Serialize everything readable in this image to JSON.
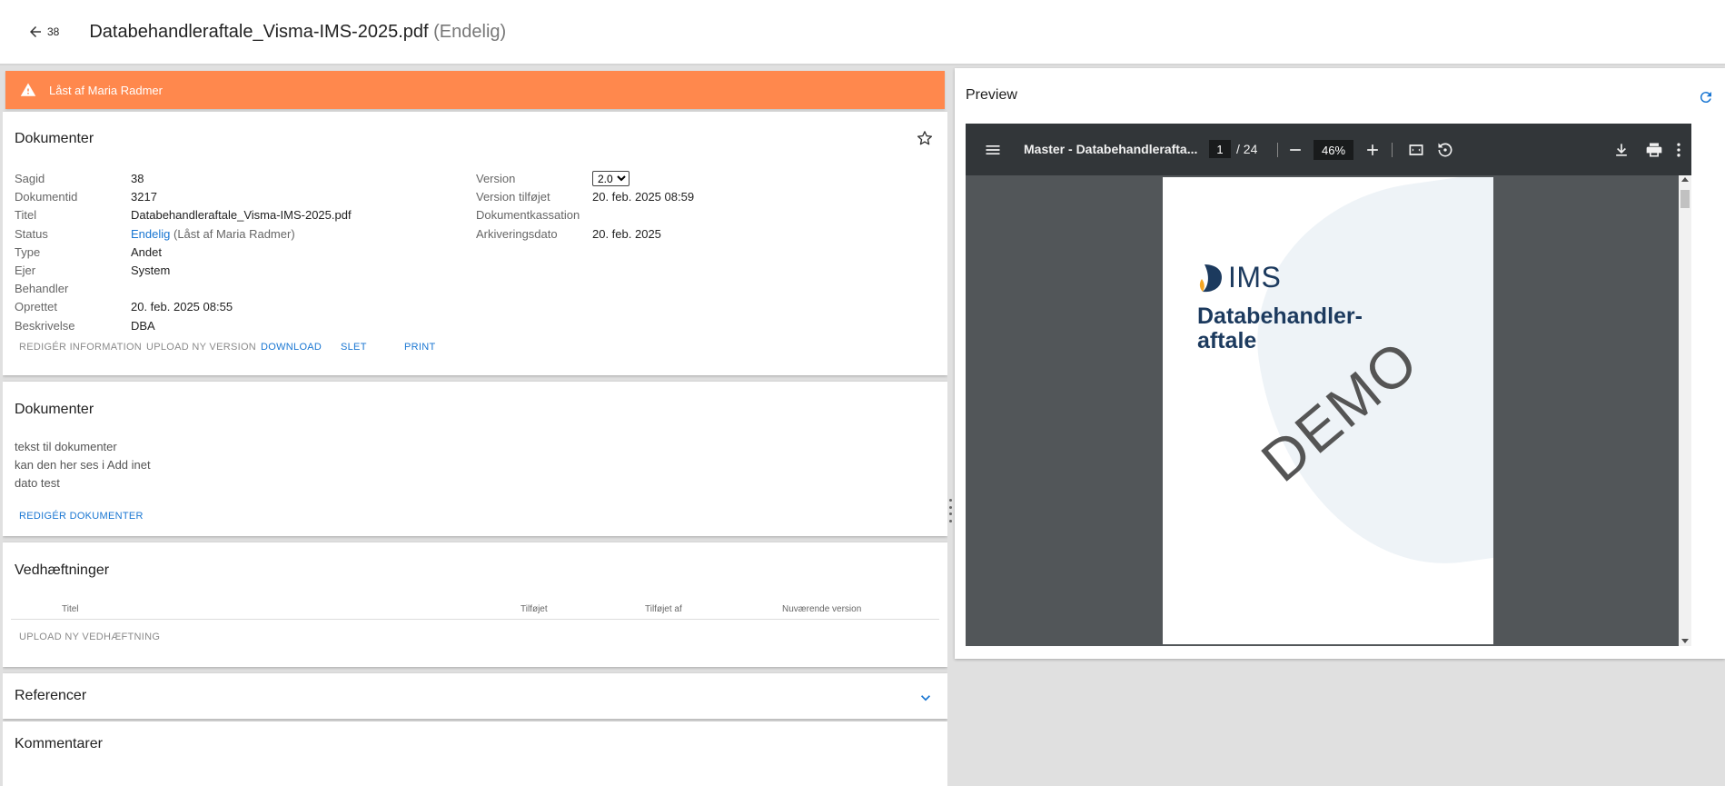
{
  "header": {
    "back_count": "38",
    "title": "Databehandleraftale_Visma-IMS-2025.pdf",
    "state": "(Endelig)"
  },
  "lock_banner": {
    "text": "Låst af Maria Radmer",
    "color": "#ff884d"
  },
  "documents_card": {
    "title": "Dokumenter",
    "left_fields": [
      {
        "label": "Sagid",
        "value": "38"
      },
      {
        "label": "Dokumentid",
        "value": "3217"
      },
      {
        "label": "Titel",
        "value": "Databehandleraftale_Visma-IMS-2025.pdf"
      },
      {
        "label": "Status",
        "value_link": "Endelig",
        "value_extra": "(Låst af Maria Radmer)"
      },
      {
        "label": "Type",
        "value": "Andet"
      },
      {
        "label": "Ejer",
        "value": "System"
      },
      {
        "label": "Behandler",
        "value": ""
      },
      {
        "label": "Oprettet",
        "value": "20. feb. 2025 08:55"
      },
      {
        "label": "Beskrivelse",
        "value": "DBA"
      }
    ],
    "right_fields": [
      {
        "label": "Version",
        "value": "2.0"
      },
      {
        "label": "Version tilføjet",
        "value": "20. feb. 2025 08:59"
      },
      {
        "label": "Dokumentkassation",
        "value": ""
      },
      {
        "label": "Arkiveringsdato",
        "value": "20. feb. 2025"
      }
    ],
    "actions": {
      "edit_info": "REDIGÉR INFORMATION",
      "upload_version": "UPLOAD NY VERSION",
      "download": "DOWNLOAD",
      "delete": "SLET",
      "print": "PRINT"
    }
  },
  "notes_card": {
    "title": "Dokumenter",
    "lines": [
      "tekst til dokumenter",
      "kan den her ses i Add inet",
      "dato test"
    ],
    "edit_label": "REDIGÉR DOKUMENTER"
  },
  "attachments_card": {
    "title": "Vedhæftninger",
    "columns": [
      "Titel",
      "Tilføjet",
      "Tilføjet af",
      "Nuværende version"
    ],
    "upload_label": "UPLOAD NY VEDHÆFTNING"
  },
  "references_card": {
    "title": "Referencer"
  },
  "comments_card": {
    "title": "Kommentarer"
  },
  "preview": {
    "title": "Preview",
    "viewer": {
      "doc_title": "Master - Databehandlerafta...",
      "page_current": "1",
      "page_total": "/ 24",
      "zoom": "46%"
    },
    "pdf": {
      "logo_text": "IMS",
      "heading_line1": "Databehandler-",
      "heading_line2": "aftale",
      "watermark": "DEMO"
    }
  },
  "colors": {
    "accent": "#1976d2",
    "banner": "#ff884d",
    "viewer_toolbar": "#323639",
    "viewer_bg": "#525659"
  }
}
